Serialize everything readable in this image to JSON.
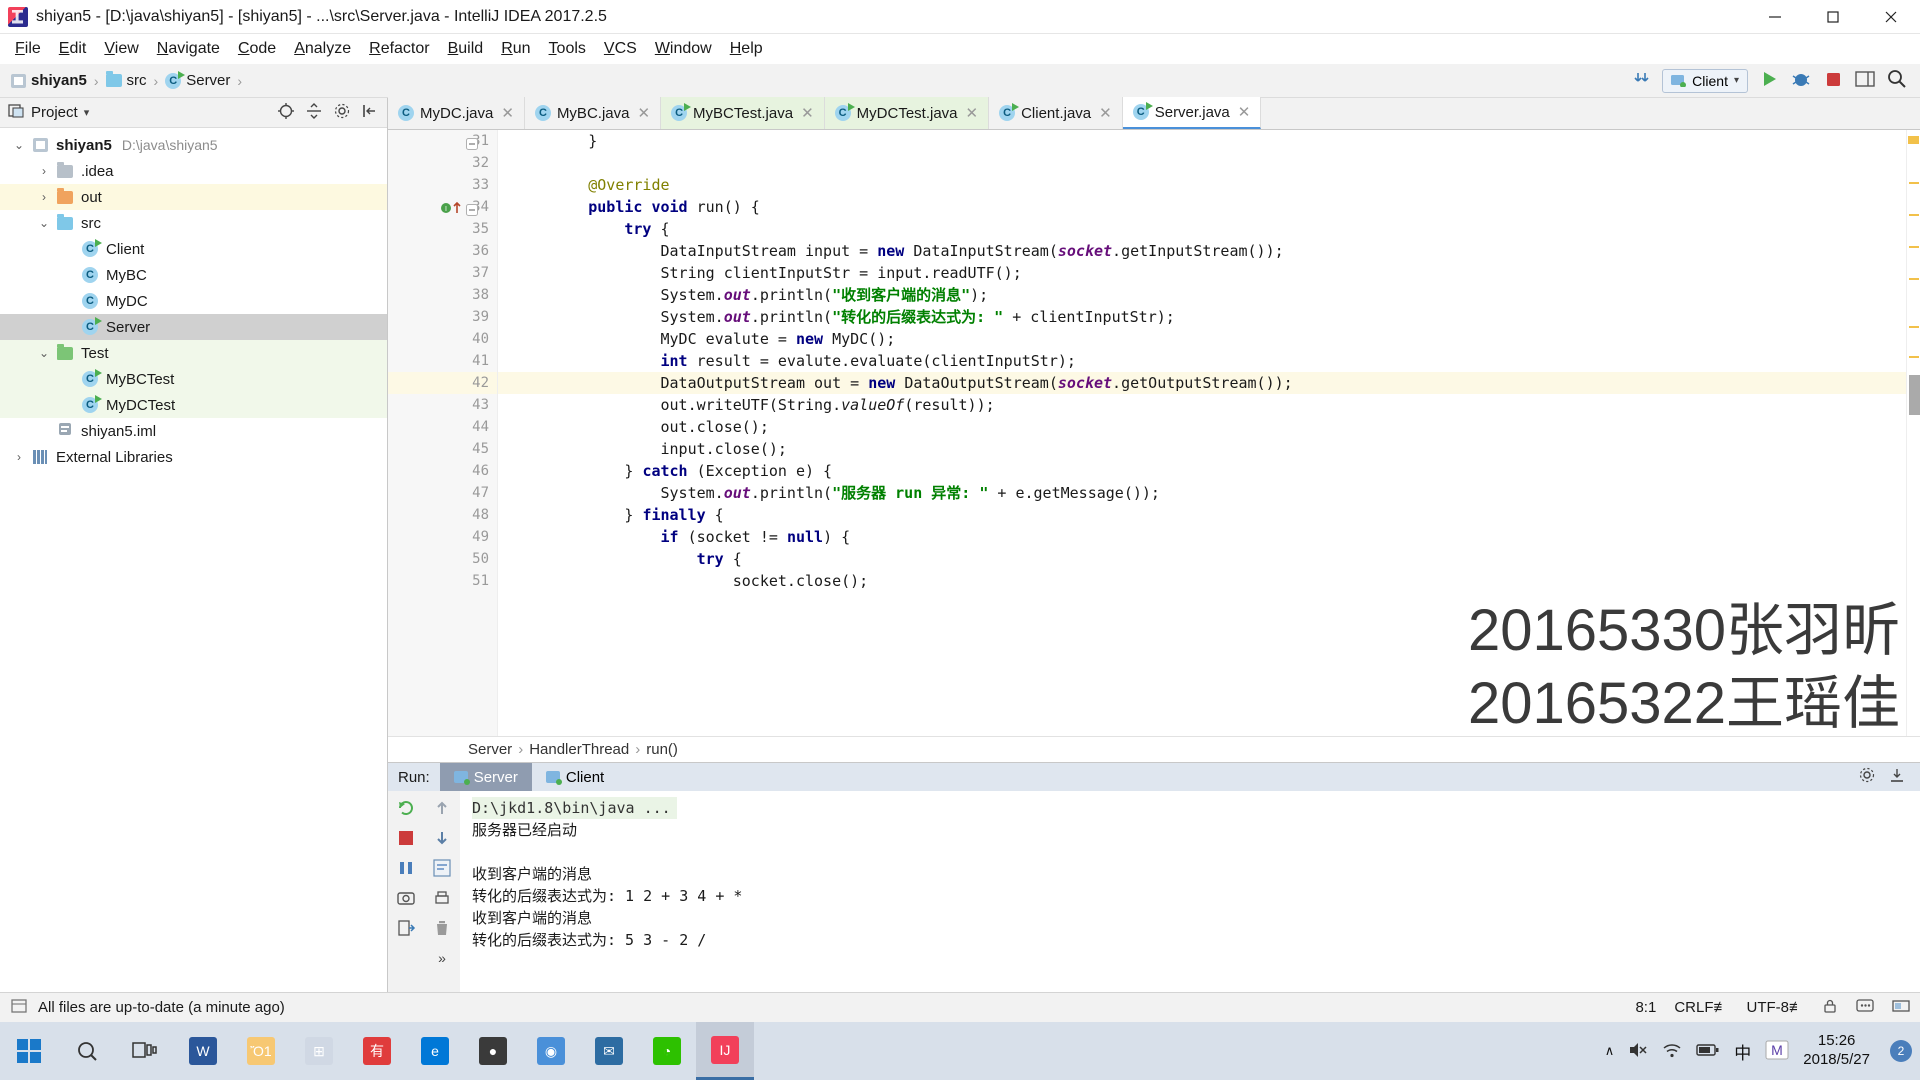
{
  "window": {
    "title": "shiyan5 - [D:\\java\\shiyan5] - [shiyan5] - ...\\src\\Server.java - IntelliJ IDEA 2017.2.5",
    "app_icon": "intellij-idea-icon",
    "minimize": "—",
    "maximize": "❐",
    "close": "✕"
  },
  "menu": {
    "items": [
      "File",
      "Edit",
      "View",
      "Navigate",
      "Code",
      "Analyze",
      "Refactor",
      "Build",
      "Run",
      "Tools",
      "VCS",
      "Window",
      "Help"
    ]
  },
  "navbar": {
    "crumbs": [
      "shiyan5",
      "src",
      "Server"
    ],
    "separator": "›",
    "run_config": "Client",
    "run_label": "Run",
    "debug_label": "Debug",
    "stop_label": "Stop",
    "search_label": "Search everywhere",
    "updates_label": "Download updates"
  },
  "project_panel": {
    "title": "Project",
    "dropdown": "▾",
    "locate_icon": "crosshair-icon",
    "collapse_icon": "collapse-all-icon",
    "settings_icon": "gear-icon",
    "hide_icon": "hide-panel-icon",
    "tree": [
      {
        "label": "shiyan5",
        "path": "D:\\java\\shiyan5",
        "depth": 0,
        "arrow": "⌄",
        "icon": "module-icon",
        "bold": true,
        "state": "normal"
      },
      {
        "label": ".idea",
        "path": "",
        "depth": 1,
        "arrow": "›",
        "icon": "folder-gray-icon",
        "bold": false,
        "state": "normal"
      },
      {
        "label": "out",
        "path": "",
        "depth": 1,
        "arrow": "›",
        "icon": "folder-orange-icon",
        "bold": false,
        "state": "yellow"
      },
      {
        "label": "src",
        "path": "",
        "depth": 1,
        "arrow": "⌄",
        "icon": "folder-blue-icon",
        "bold": false,
        "state": "normal"
      },
      {
        "label": "Client",
        "path": "",
        "depth": 2,
        "arrow": "",
        "icon": "java-class-runnable-icon",
        "bold": false,
        "state": "normal"
      },
      {
        "label": "MyBC",
        "path": "",
        "depth": 2,
        "arrow": "",
        "icon": "java-class-icon",
        "bold": false,
        "state": "normal"
      },
      {
        "label": "MyDC",
        "path": "",
        "depth": 2,
        "arrow": "",
        "icon": "java-class-icon",
        "bold": false,
        "state": "normal"
      },
      {
        "label": "Server",
        "path": "",
        "depth": 2,
        "arrow": "",
        "icon": "java-class-runnable-icon",
        "bold": false,
        "state": "selected"
      },
      {
        "label": "Test",
        "path": "",
        "depth": 1,
        "arrow": "⌄",
        "icon": "folder-green-icon",
        "bold": false,
        "state": "green"
      },
      {
        "label": "MyBCTest",
        "path": "",
        "depth": 2,
        "arrow": "",
        "icon": "java-class-runnable-icon",
        "bold": false,
        "state": "green"
      },
      {
        "label": "MyDCTest",
        "path": "",
        "depth": 2,
        "arrow": "",
        "icon": "java-class-runnable-icon",
        "bold": false,
        "state": "green"
      },
      {
        "label": "shiyan5.iml",
        "path": "",
        "depth": 1,
        "arrow": "",
        "icon": "iml-file-icon",
        "bold": false,
        "state": "normal"
      },
      {
        "label": "External Libraries",
        "path": "",
        "depth": 0,
        "arrow": "›",
        "icon": "library-icon",
        "bold": false,
        "state": "normal"
      }
    ]
  },
  "editor": {
    "tabs": [
      {
        "label": "MyDC.java",
        "icon": "java-class-icon",
        "active": false,
        "green": false
      },
      {
        "label": "MyBC.java",
        "icon": "java-class-icon",
        "active": false,
        "green": false
      },
      {
        "label": "MyBCTest.java",
        "icon": "java-class-runnable-icon",
        "active": false,
        "green": true
      },
      {
        "label": "MyDCTest.java",
        "icon": "java-class-runnable-icon",
        "active": false,
        "green": true
      },
      {
        "label": "Client.java",
        "icon": "java-class-runnable-icon",
        "active": false,
        "green": false
      },
      {
        "label": "Server.java",
        "icon": "java-class-runnable-icon",
        "active": true,
        "green": false
      }
    ],
    "close_glyph": "✕",
    "first_line_number": 31,
    "highlight_line": 42,
    "lines": [
      {
        "n": 31,
        "html": "        }"
      },
      {
        "n": 32,
        "html": ""
      },
      {
        "n": 33,
        "html": "        <span class='ann'>@Override</span>"
      },
      {
        "n": 34,
        "html": "        <span class='kw'>public</span> <span class='kw'>void</span> run() {"
      },
      {
        "n": 35,
        "html": "            <span class='kw'>try</span> {"
      },
      {
        "n": 36,
        "html": "                DataInputStream input = <span class='kw'>new</span> DataInputStream(<span class='fld2'>socket</span>.getInputStream());"
      },
      {
        "n": 37,
        "html": "                String clientInputStr = input.readUTF();"
      },
      {
        "n": 38,
        "html": "                System.<span class='fld2'>out</span>.println(<span class='str'>\"收到客户端的消息\"</span>);"
      },
      {
        "n": 39,
        "html": "                System.<span class='fld2'>out</span>.println(<span class='str'>\"转化的后缀表达式为: \"</span> + clientInputStr);"
      },
      {
        "n": 40,
        "html": "                MyDC evalute = <span class='kw'>new</span> MyDC();"
      },
      {
        "n": 41,
        "html": "                <span class='kw'>int</span> result = evalute.evaluate(clientInputStr);"
      },
      {
        "n": 42,
        "html": "                DataOutputStream out = <span class='kw'>new</span> DataOutputStream(<span class='fld2'>socket</span>.getOutputStream());"
      },
      {
        "n": 43,
        "html": "                out.writeUTF(String.<span class='stat-it'>valueOf</span>(result));"
      },
      {
        "n": 44,
        "html": "                out.close();"
      },
      {
        "n": 45,
        "html": "                input.close();"
      },
      {
        "n": 46,
        "html": "            } <span class='kw'>catch</span> (Exception e) {"
      },
      {
        "n": 47,
        "html": "                System.<span class='fld2'>out</span>.println(<span class='str'>\"服务器 run 异常: \"</span> + e.getMessage());"
      },
      {
        "n": 48,
        "html": "            } <span class='kw'>finally</span> {"
      },
      {
        "n": 49,
        "html": "                <span class='kw'>if</span> (socket != <span class='kw'>null</span>) {"
      },
      {
        "n": 50,
        "html": "                    <span class='kw'>try</span> {"
      },
      {
        "n": 51,
        "html": "                        socket.close();"
      }
    ],
    "breadcrumb": [
      "Server",
      "HandlerThread",
      "run()"
    ],
    "breadcrumb_separator": "›",
    "watermark_line1": "20165330张羽昕",
    "watermark_line2": "20165322王瑶佳",
    "gutter_marker_line": 34,
    "gutter_marker_icon": "method-implements-icon"
  },
  "run_window": {
    "label": "Run:",
    "tabs": [
      {
        "label": "Server",
        "active": true
      },
      {
        "label": "Client",
        "active": false
      }
    ],
    "settings_icon": "gear-icon",
    "hide_icon": "hide-panel-icon",
    "left_buttons": [
      "rerun-icon",
      "up-arrow-icon",
      "pause-icon",
      "screenshot-icon",
      "export-icon"
    ],
    "left_buttons2": [
      "stop-icon",
      "down-arrow-icon",
      "wrap-icon",
      "print-icon",
      "trash-icon"
    ],
    "expand_icon": "»",
    "console": [
      {
        "text": "D:\\jkd1.8\\bin\\java ...",
        "header": true
      },
      {
        "text": "服务器已经启动",
        "header": false
      },
      {
        "text": "",
        "header": false
      },
      {
        "text": "收到客户端的消息",
        "header": false
      },
      {
        "text": "转化的后缀表达式为: 1 2 + 3 4 + *",
        "header": false
      },
      {
        "text": "收到客户端的消息",
        "header": false
      },
      {
        "text": "转化的后缀表达式为: 5 3 - 2 /",
        "header": false
      }
    ]
  },
  "status_bar": {
    "message": "All files are up-to-date (a minute ago)",
    "caret_position": "8:1",
    "line_separator": "CRLF≢",
    "encoding": "UTF-8≢",
    "lock_icon": "lock-icon",
    "event_icon": "event-log-icon",
    "memory_icon": "memory-indicator"
  },
  "taskbar": {
    "start_icon": "windows-start-icon",
    "search_icon": "cortana-search-icon",
    "taskview_icon": "task-view-icon",
    "apps": [
      {
        "name": "word-icon",
        "glyph": "W",
        "color": "#2b579a",
        "active": false
      },
      {
        "name": "file-explorer-icon",
        "glyph": "Ὄ1",
        "color": "#f7c873",
        "active": false
      },
      {
        "name": "microsoft-store-icon",
        "glyph": "⊞",
        "color": "#d0d8e4",
        "active": false
      },
      {
        "name": "youdao-dict-icon",
        "glyph": "有",
        "color": "#e03c3c",
        "active": false
      },
      {
        "name": "edge-browser-icon",
        "glyph": "e",
        "color": "#0078d7",
        "active": false
      },
      {
        "name": "tim-icon",
        "glyph": "●",
        "color": "#3a3a3a",
        "active": false
      },
      {
        "name": "chrome-browser-icon",
        "glyph": "◉",
        "color": "#4a90d9",
        "active": false
      },
      {
        "name": "mail-icon",
        "glyph": "✉",
        "color": "#2d6ca2",
        "active": false
      },
      {
        "name": "wechat-icon",
        "glyph": "◔",
        "color": "#2dc100",
        "active": false
      },
      {
        "name": "intellij-idea-icon",
        "glyph": "IJ",
        "color": "#f2405a",
        "active": true
      }
    ],
    "tray": {
      "chevron_up": "∧",
      "volume_icon": "volume-mute-icon",
      "network_icon": "wifi-icon",
      "battery_icon": "battery-icon",
      "ime_indicator": "中",
      "ime_logo": "M",
      "time": "15:26",
      "date": "2018/5/27",
      "notification_count": "2"
    }
  },
  "colors": {
    "accent": "#4a90d9",
    "selection": "#d0d0d0",
    "highlight_yellow": "#fdf9e5",
    "test_green": "#f1f8ea",
    "keyword_blue": "#000080",
    "string_green": "#008000",
    "annotation_olive": "#808000",
    "field_purple": "#660e7a"
  }
}
